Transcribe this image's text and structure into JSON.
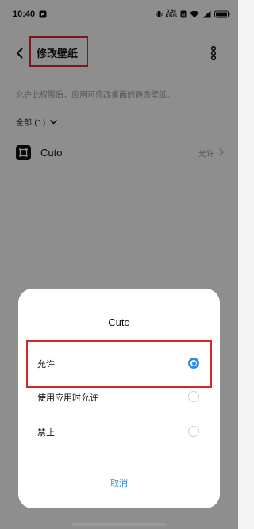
{
  "status_bar": {
    "time": "10:40",
    "speed_value": "0.60",
    "speed_unit": "KB/S",
    "battery": "100"
  },
  "header": {
    "title": "修改壁纸"
  },
  "description": "允许此权限后，应用可修改桌面的静态壁纸。",
  "filter": {
    "label": "全部 (1)"
  },
  "app_list": [
    {
      "name": "Cuto",
      "status": "允许"
    }
  ],
  "dialog": {
    "title": "Cuto",
    "options": [
      {
        "label": "允许",
        "selected": true
      },
      {
        "label": "使用应用时允许",
        "selected": false
      },
      {
        "label": "禁止",
        "selected": false
      }
    ],
    "cancel_label": "取消"
  },
  "colors": {
    "accent": "#2f8ee5",
    "highlight_box": "#d8262e"
  }
}
